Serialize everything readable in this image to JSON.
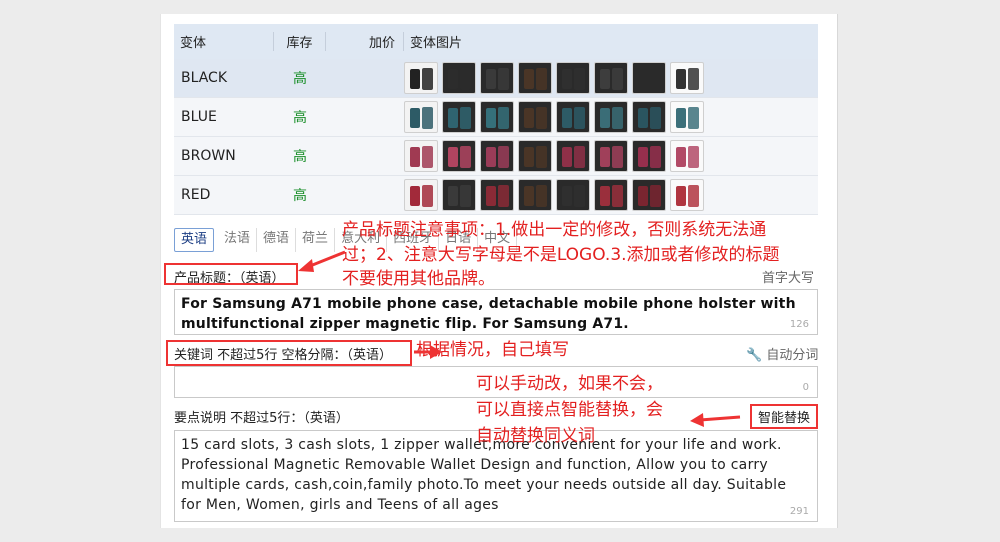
{
  "table": {
    "headers": {
      "variant": "变体",
      "stock": "库存",
      "add_price": "加价",
      "images": "变体图片"
    },
    "rows": [
      {
        "variant": "BLACK",
        "stock": "高",
        "thumb_colors": [
          "#222222",
          "#2c2c2c",
          "#3a3a3a",
          "#4a3526",
          "#2f2f2f",
          "#3d3d3d",
          "#2a2a2a",
          "#333333"
        ]
      },
      {
        "variant": "BLUE",
        "stock": "高",
        "thumb_colors": [
          "#2d5b66",
          "#2f6470",
          "#35707a",
          "#4a3526",
          "#2d5b66",
          "#3a6d77",
          "#2a5560",
          "#3c707a"
        ]
      },
      {
        "variant": "BROWN",
        "stock": "高",
        "thumb_colors": [
          "#a03a52",
          "#b04460",
          "#9a3c58",
          "#4a3526",
          "#8f3048",
          "#a0405a",
          "#962f4d",
          "#b24a66"
        ]
      },
      {
        "variant": "RED",
        "stock": "高",
        "thumb_colors": [
          "#a22a3a",
          "#3a3a3a",
          "#8a2a36",
          "#4a3526",
          "#2f2f2f",
          "#9a2f3c",
          "#7a2530",
          "#b0353f"
        ]
      }
    ]
  },
  "lang_tabs": [
    "英语",
    "法语",
    "德语",
    "荷兰",
    "意大利",
    "西班牙",
    "日语",
    "中文"
  ],
  "title_field": {
    "label": "产品标题：（英语）",
    "hint": "首字大写",
    "value": "For Samsung A71 mobile phone case, detachable mobile phone holster with multifunctional zipper magnetic flip. For Samsung A71.",
    "count": "126"
  },
  "keywords_field": {
    "label": "关键词 不超过5行 空格分隔：（英语）",
    "hint": "自动分词",
    "value": "",
    "count": "0"
  },
  "points_field": {
    "label": "要点说明 不超过5行：（英语）",
    "smart_replace": "智能替换",
    "value": "15 card slots, 3 cash slots, 1 zipper wallet,more convenient for your life and work. Professional Magnetic Removable Wallet Design and function, Allow you to carry multiple cards, cash,coin,family photo.To meet your needs outside all day. Suitable for Men, Women, girls and Teens of all ages",
    "count": "291"
  },
  "annotations": {
    "title_note_1": "产品标题注意事项：1.做出一定的修改，否则系统无法通",
    "title_note_2": "过；2、注意大写字母是不是LOGO.3.添加或者修改的标题",
    "title_note_3": "不要使用其他品牌。",
    "keyword_note": "根据情况，自己填写",
    "smart_note_1": "可以手动改，如果不会，",
    "smart_note_2": "可以直接点智能替换，会",
    "smart_note_3": "自动替换同义词",
    "color": "#e32020"
  }
}
